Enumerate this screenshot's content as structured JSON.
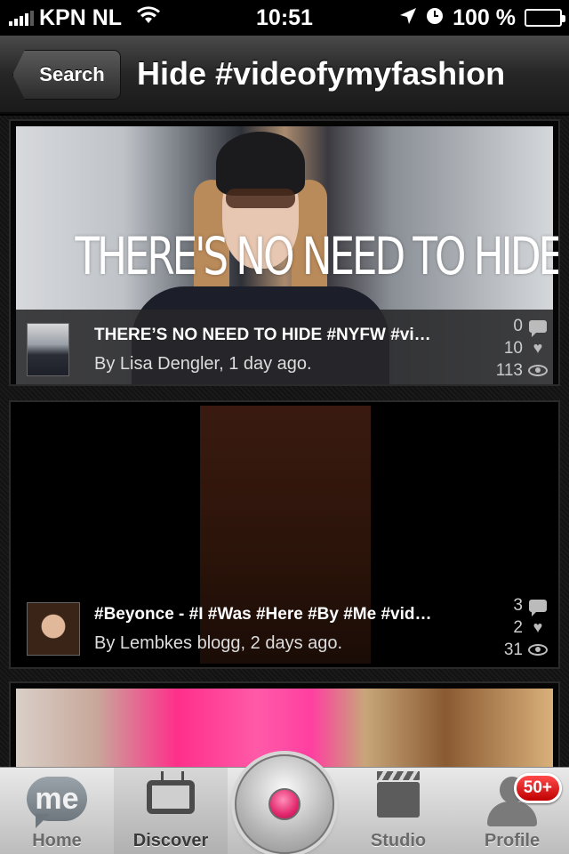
{
  "status_bar": {
    "carrier": "KPN NL",
    "time": "10:51",
    "battery": "100 %"
  },
  "nav": {
    "back_label": "Search",
    "title": "Hide #videofymyfashion"
  },
  "posts": [
    {
      "overlay_text": "THERE'S NO NEED TO HIDE #NYFW",
      "title": "THERE’S NO NEED TO HIDE #NYFW #vi…",
      "byline": "By Lisa Dengler, 1 day ago.",
      "comments": "0",
      "likes": "10",
      "views": "113"
    },
    {
      "title": "#Beyonce - #I #Was #Here #By #Me #vid…",
      "byline": "By Lembkes blogg, 2 days ago.",
      "comments": "3",
      "likes": "2",
      "views": "31"
    }
  ],
  "tab_bar": {
    "home": "Home",
    "discover": "Discover",
    "studio": "Studio",
    "profile": "Profile",
    "profile_badge": "50+",
    "me_icon_text": "me",
    "active_tab": "discover"
  },
  "icons": {
    "comment": "comment-bubble-icon",
    "like": "heart-icon",
    "views": "eye-icon"
  },
  "colors": {
    "record_accent": "#e2286e",
    "badge": "#d40000"
  }
}
